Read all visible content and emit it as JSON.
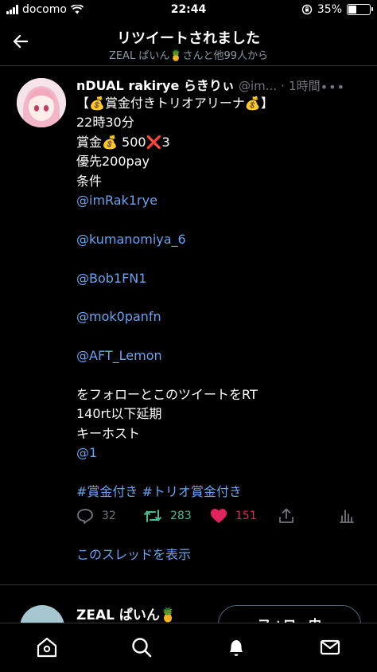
{
  "status_bar": {
    "carrier": "docomo",
    "time": "22:44",
    "battery": "35%"
  },
  "header": {
    "title": "リツイートされました",
    "subtitle": "ZEAL ぱいん🍍さんと他99人から"
  },
  "tweet": {
    "author_name": "nDUAL rakirye らきりぃ",
    "handle": "@im...",
    "time": "1時間",
    "lines": [
      "【💰賞金付きトリオアリーナ💰】",
      "22時30分",
      "賞金💰 500❌3",
      "優先200pay",
      "条件",
      "@imRak1rye",
      "",
      "@kumanomiya_6",
      "",
      "@Bob1FN1",
      "",
      "@mok0panfn",
      "",
      "@AFT_Lemon",
      "",
      "をフォローとこのツイートをRT",
      "140rt以下延期",
      "キーホスト",
      "@1",
      "",
      "#賞金付き #トリオ賞金付き"
    ],
    "reply_count": "32",
    "retweet_count": "283",
    "like_count": "151",
    "thread_link": "このスレッドを表示"
  },
  "next_tweet": {
    "author_name": "ZEAL ぱいん🍍",
    "follow_label": "フォロー中"
  },
  "colors": {
    "link": "#6aa3f0",
    "retweet": "#4fb88c",
    "like": "#e0245e",
    "muted": "#71767b"
  },
  "icons": [
    "back-arrow-icon",
    "more-icon",
    "reply-icon",
    "retweet-icon",
    "heart-icon",
    "share-icon",
    "stats-icon",
    "home-icon",
    "search-icon",
    "bell-icon",
    "mail-icon"
  ]
}
